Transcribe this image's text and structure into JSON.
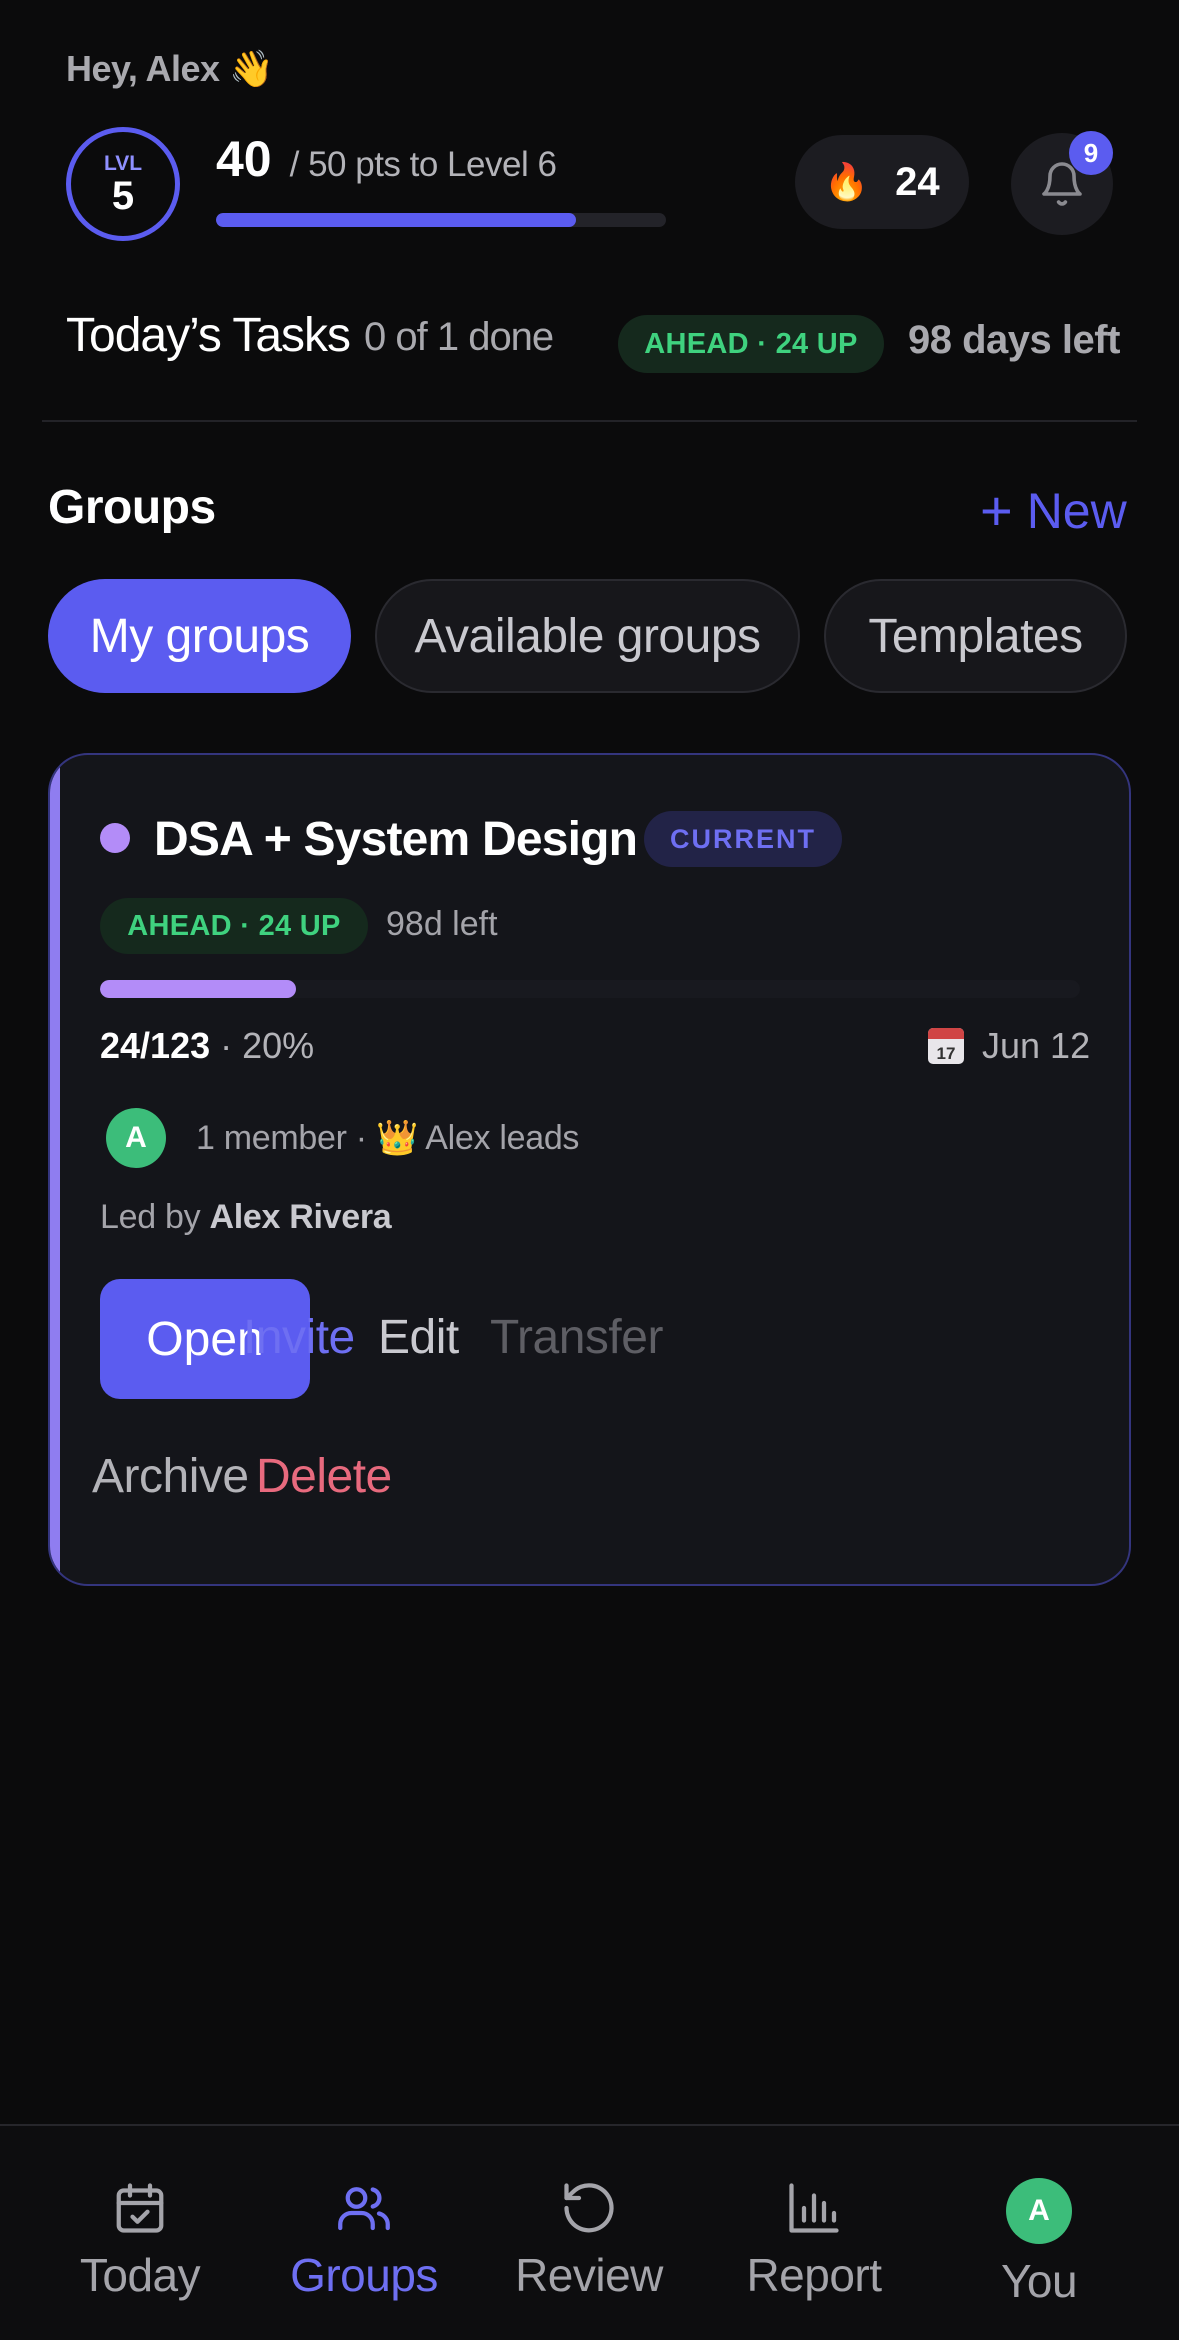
{
  "header": {
    "greeting": "Hey, Alex 👋",
    "level_label": "LVL",
    "level_value": "5",
    "points": "40",
    "points_text": "/ 50 pts to Level 6",
    "xp_progress": 0.8,
    "streak_icon": "fire-icon",
    "streak_value": "24",
    "notification_count": "9"
  },
  "today": {
    "title": "Today’s Tasks",
    "done": "0 of 1 done",
    "status": "AHEAD · 24 UP",
    "days_left": "98 days left"
  },
  "groups": {
    "title": "Groups",
    "new_label": "New",
    "tabs": [
      {
        "label": "My groups",
        "active": true
      },
      {
        "label": "Available groups",
        "active": false
      },
      {
        "label": "Templates",
        "active": false
      }
    ],
    "card": {
      "name": "DSA + System Design",
      "badge": "CURRENT",
      "status": "AHEAD · 24 UP",
      "left": "98d left",
      "progress": 0.2,
      "count": "24/123",
      "percent": "· 20%",
      "due": "Jun 12",
      "calendar_day": "17",
      "avatar_initial": "A",
      "members": "1 member · 👑 Alex leads",
      "led_by_prefix": "Led by",
      "led_by_name": "Alex Rivera",
      "actions": {
        "open": "Open",
        "invite": "Invite",
        "edit": "Edit",
        "transfer": "Transfer",
        "archive": "Archive",
        "delete": "Delete"
      }
    }
  },
  "colors": {
    "accent": "#5b5cf0",
    "group_accent": "#b38cf8",
    "success": "#3fd27f",
    "danger": "#e86a7e"
  },
  "nav": {
    "items": [
      {
        "label": "Today",
        "icon": "calendar-check-icon"
      },
      {
        "label": "Groups",
        "icon": "users-icon",
        "active": true
      },
      {
        "label": "Review",
        "icon": "rotate-ccw-icon"
      },
      {
        "label": "Report",
        "icon": "bar-chart-icon"
      },
      {
        "label": "You",
        "icon": "avatar",
        "initial": "A"
      }
    ]
  }
}
